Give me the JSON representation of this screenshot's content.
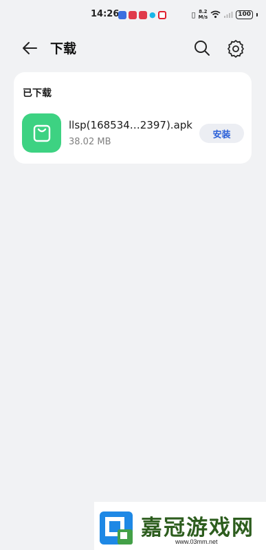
{
  "status_bar": {
    "time": "14:26",
    "net_speed_value": "8.2",
    "net_speed_unit": "M/s",
    "battery": "100",
    "notif_colors": [
      "#3b6fe0",
      "#e03a4a",
      "#e03a4a",
      "#19b6e8",
      "#e02030"
    ]
  },
  "header": {
    "title": "下载",
    "back_icon": "arrow-left-icon",
    "search_icon": "search-icon",
    "settings_icon": "gear-icon"
  },
  "downloaded": {
    "section_title": "已下载",
    "items": [
      {
        "name": "llsp(168534…2397).apk",
        "size": "38.02 MB",
        "action_label": "安装",
        "icon": "shopping-bag-icon",
        "icon_color": "#3dd282"
      }
    ]
  },
  "watermark": {
    "brand": "嘉冠游戏网",
    "url": "www.03mm.net"
  },
  "colors": {
    "background": "#f1f2f4",
    "card": "#ffffff",
    "accent": "#2a5fd8"
  }
}
